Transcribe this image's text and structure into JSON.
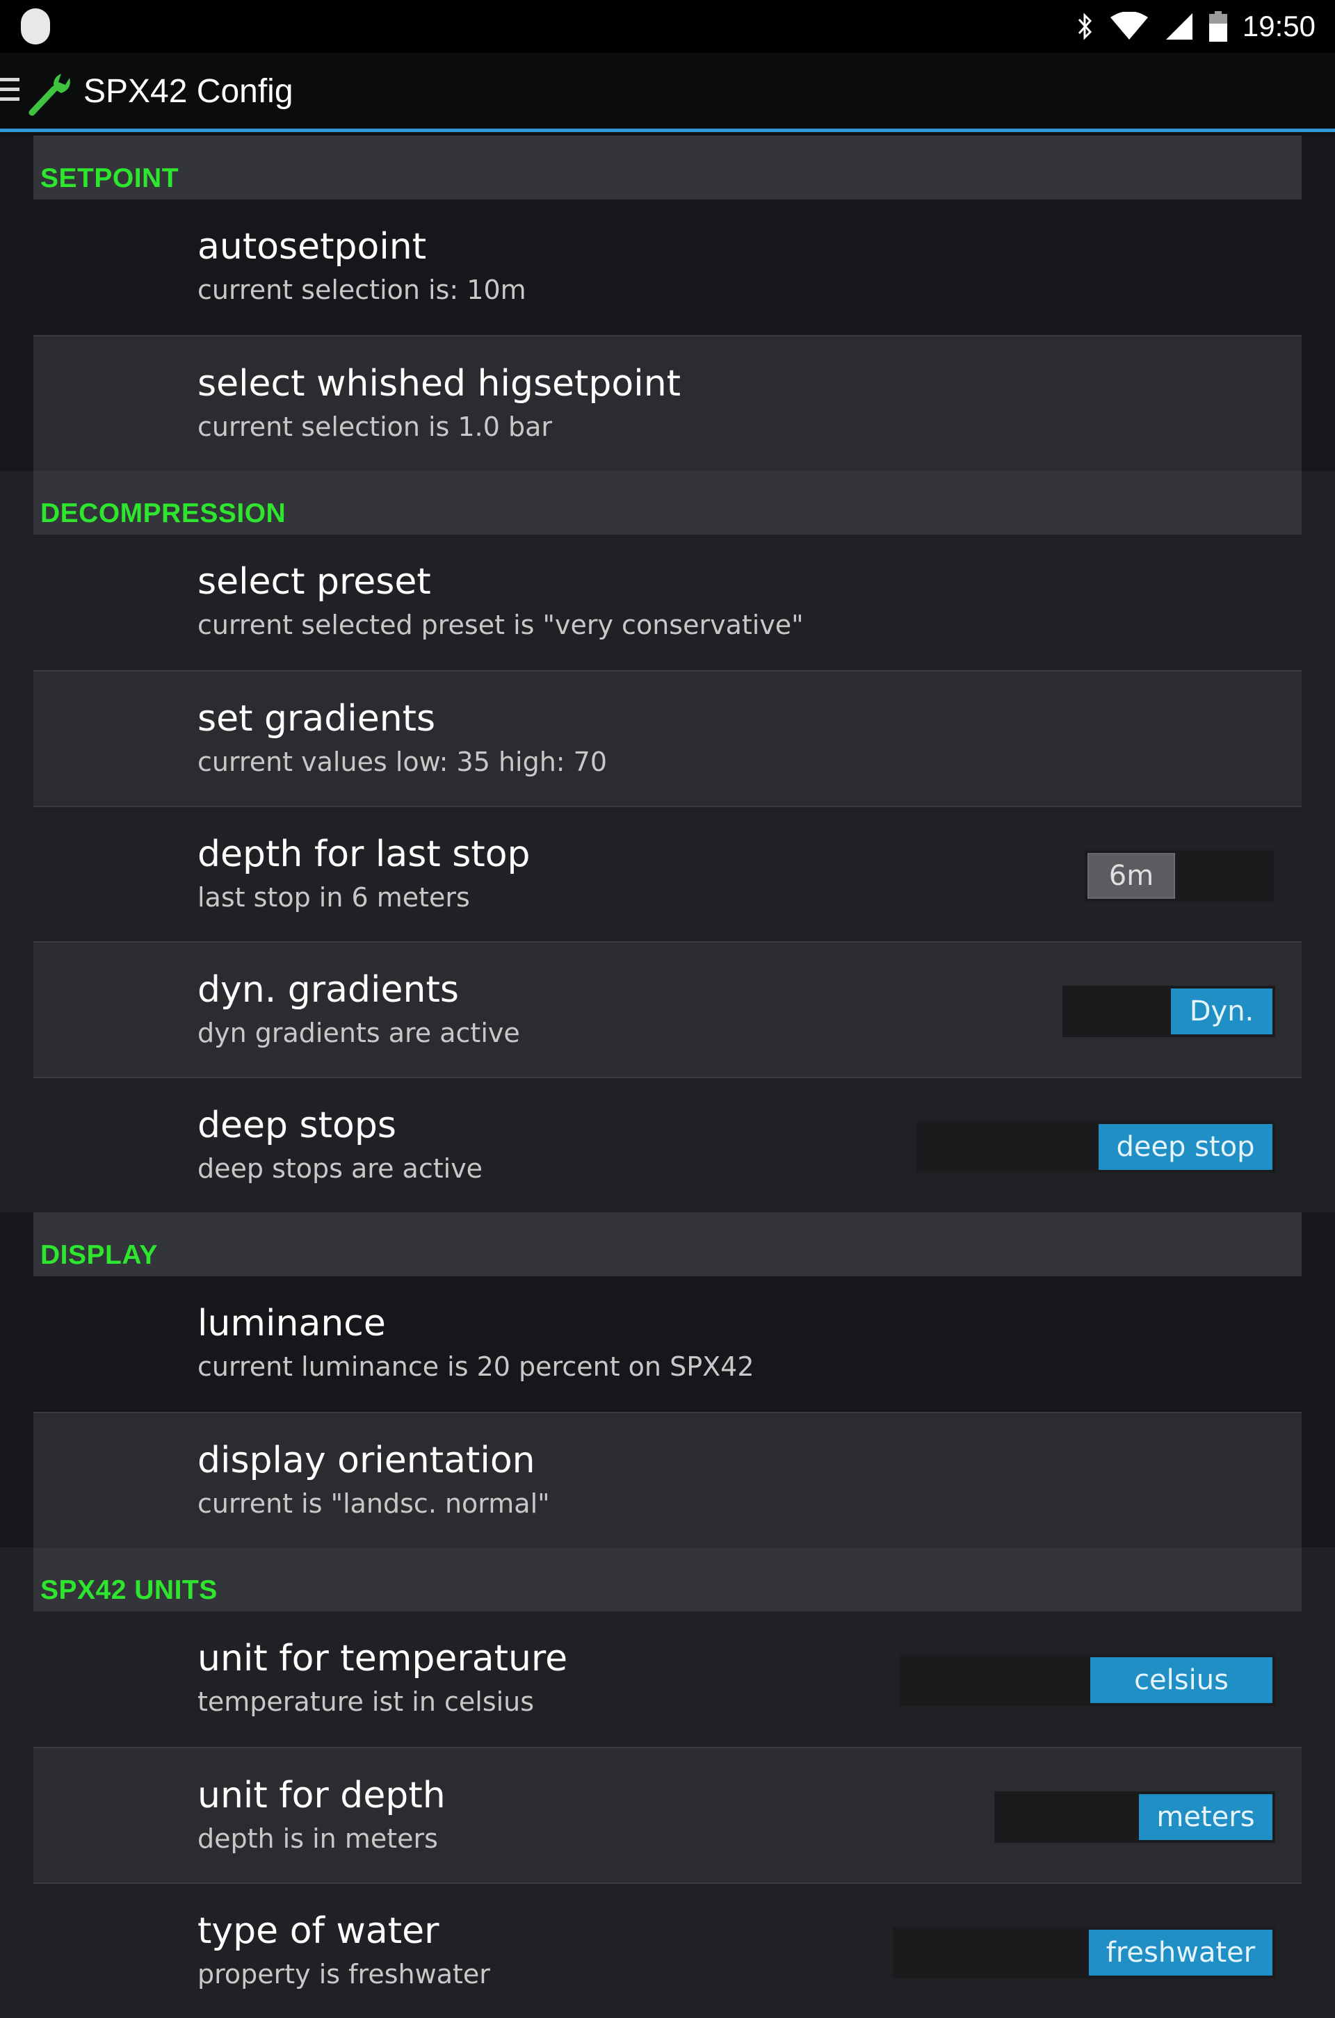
{
  "status_bar": {
    "time": "19:50",
    "icons": [
      "bluetooth-icon",
      "wifi-icon",
      "signal-icon",
      "battery-icon"
    ]
  },
  "action_bar": {
    "title": "SPX42 Config",
    "icons": [
      "drawer-menu-icon",
      "wrench-icon"
    ]
  },
  "colors": {
    "accent": "#2d9bd8",
    "category": "#2ee62e",
    "toggle_on": "#1f8fc6"
  },
  "sections": {
    "setpoint": {
      "header": "SETPOINT",
      "items": [
        {
          "title": "autosetpoint",
          "summary": "current selection is: 10m"
        },
        {
          "title": "select whished higsetpoint",
          "summary": "current selection is 1.0 bar"
        }
      ]
    },
    "decompression": {
      "header": "DECOMPRESSION",
      "items": [
        {
          "title": "select preset",
          "summary": "current selected preset is \"very conservative\""
        },
        {
          "title": "set gradients",
          "summary": "current values low: 35 high: 70"
        },
        {
          "title": "depth for last stop",
          "summary": "last stop in 6 meters",
          "toggle": {
            "label": "6m",
            "on": false
          }
        },
        {
          "title": "dyn. gradients",
          "summary": "dyn gradients are active",
          "toggle": {
            "label": "Dyn.",
            "on": true
          }
        },
        {
          "title": "deep stops",
          "summary": "deep stops are active",
          "toggle": {
            "label": "deep stop",
            "on": true
          }
        }
      ]
    },
    "display": {
      "header": "DISPLAY",
      "items": [
        {
          "title": "luminance",
          "summary": "current luminance is 20 percent on SPX42"
        },
        {
          "title": "display orientation",
          "summary": "current is \"landsc. normal\""
        }
      ]
    },
    "units": {
      "header": "SPX42 UNITS",
      "items": [
        {
          "title": "unit for temperature",
          "summary": "temperature ist in celsius",
          "toggle": {
            "label": "celsius",
            "on": true
          }
        },
        {
          "title": "unit for depth",
          "summary": "depth is in meters",
          "toggle": {
            "label": "meters",
            "on": true
          }
        },
        {
          "title": "type of water",
          "summary": "property is freshwater",
          "toggle": {
            "label": "freshwater",
            "on": true
          }
        }
      ]
    }
  }
}
